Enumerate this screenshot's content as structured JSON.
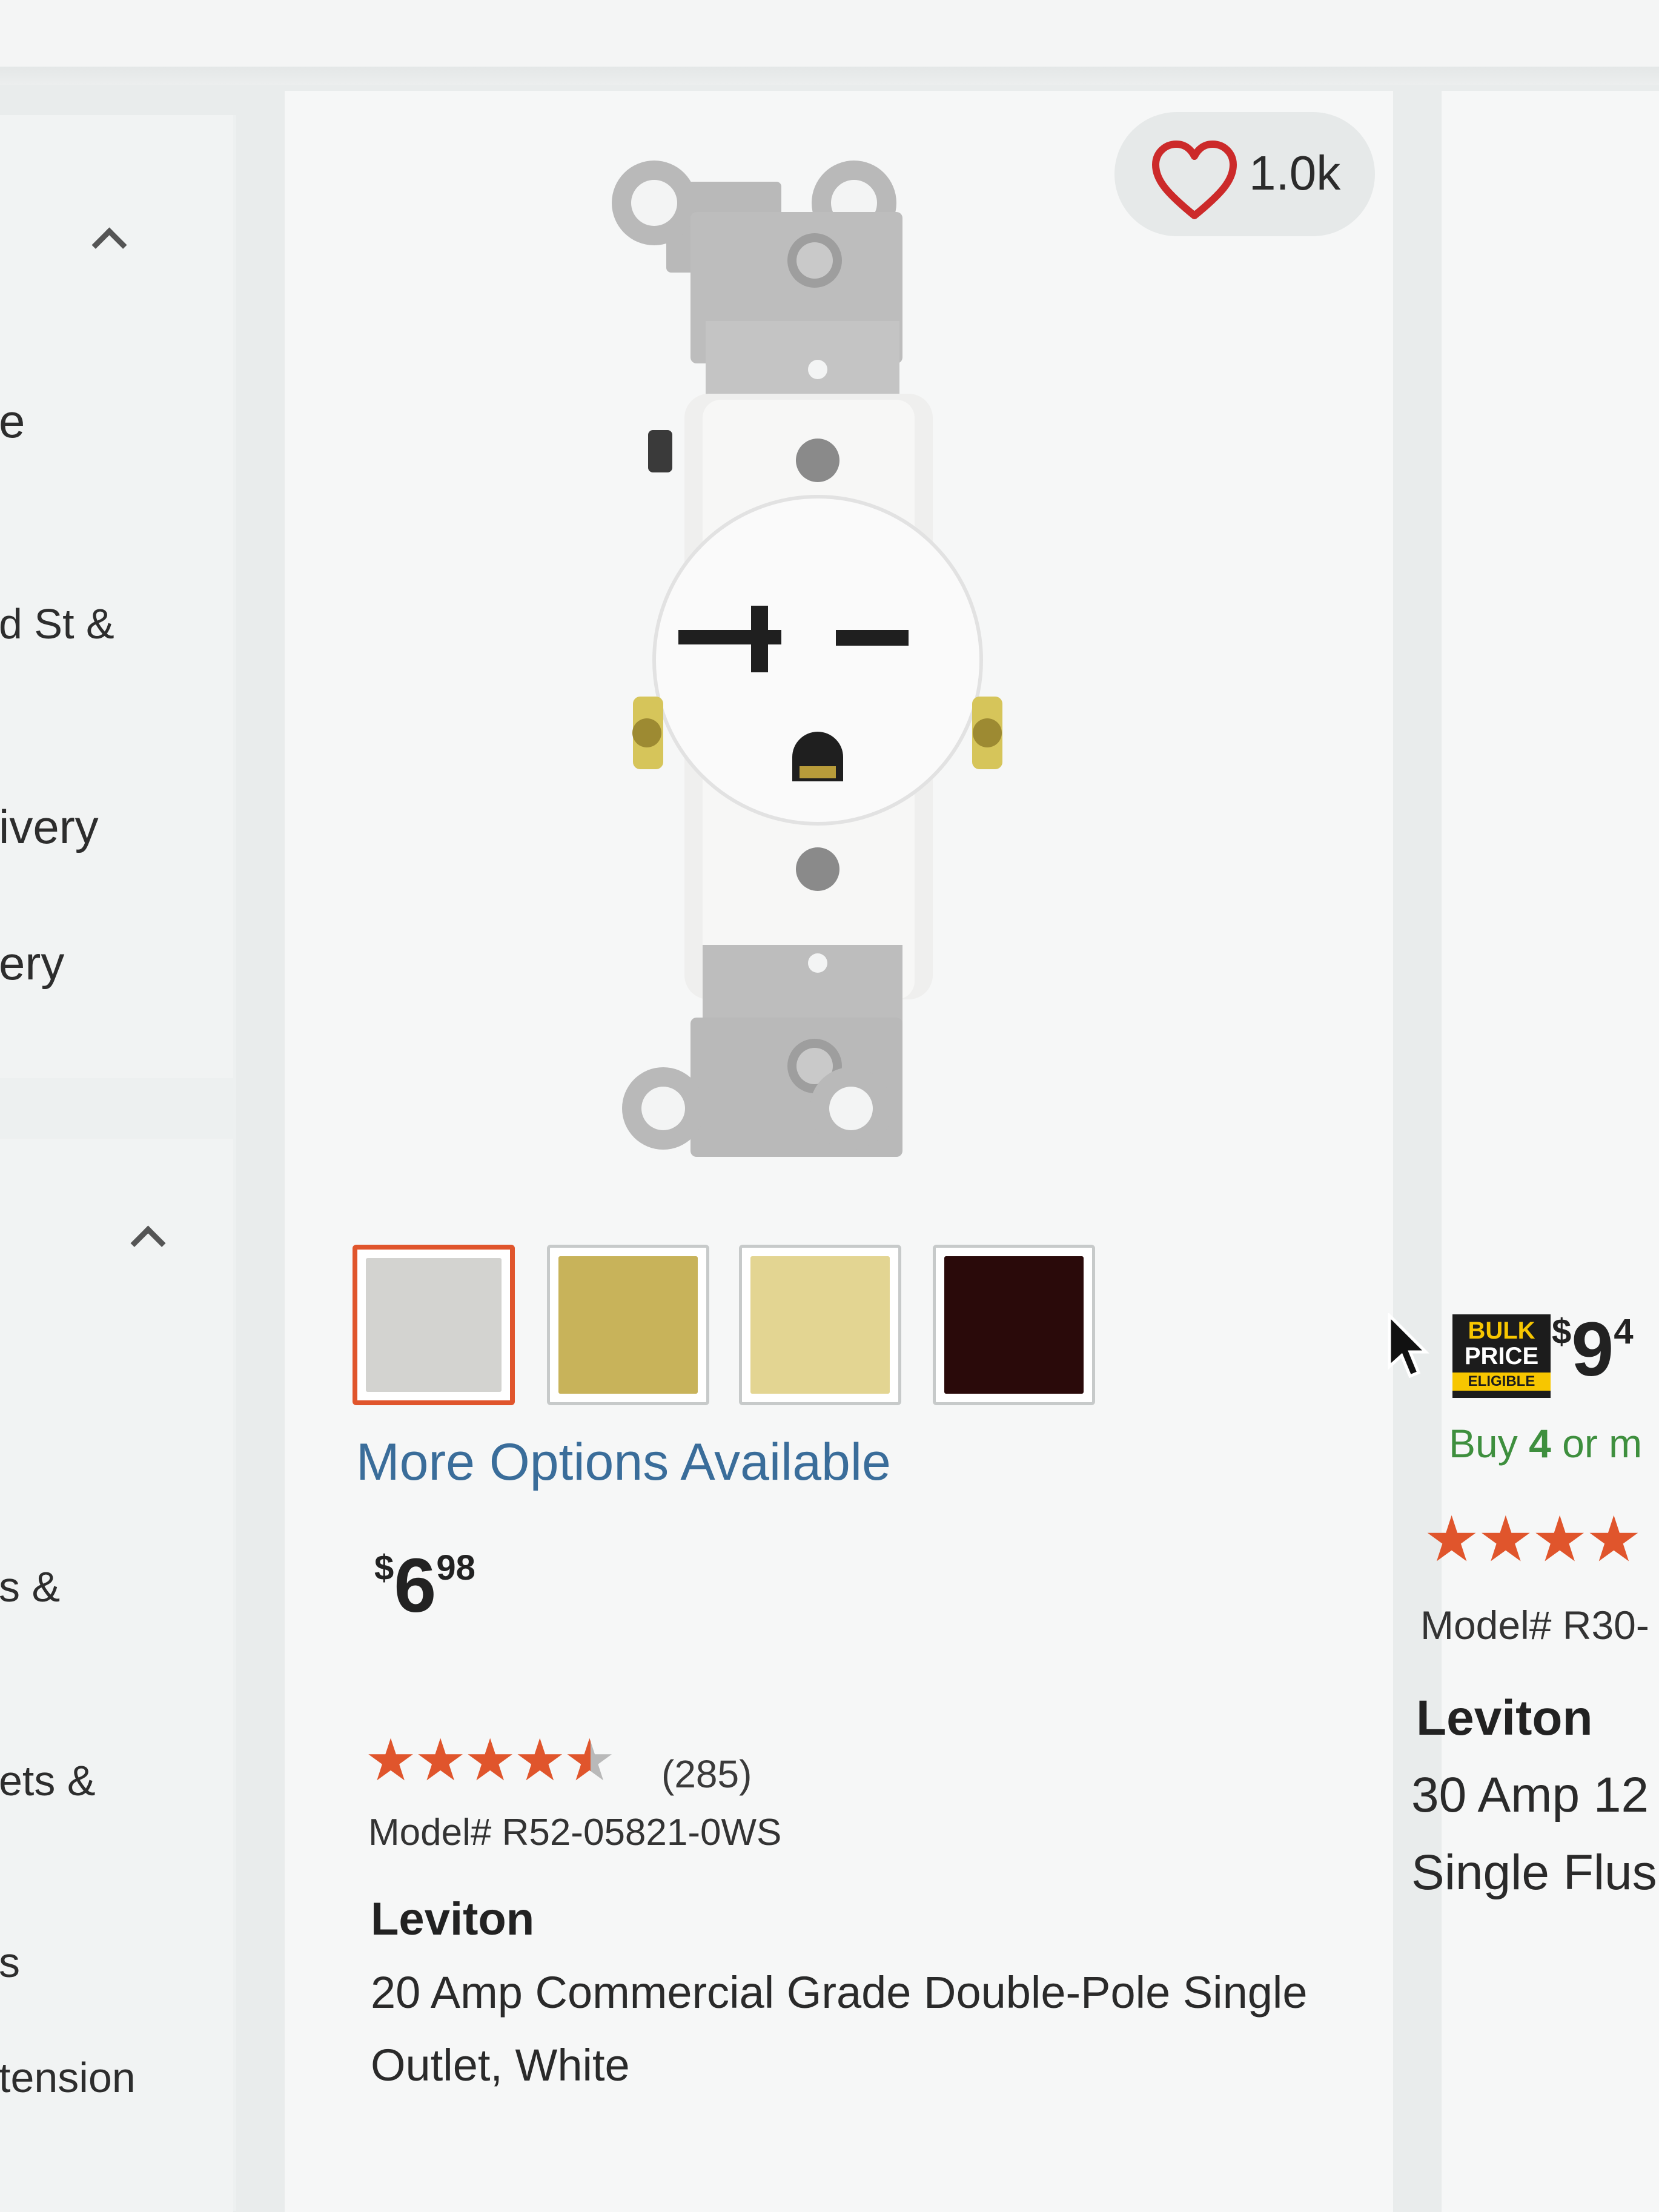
{
  "sidebar": {
    "items": [
      "e",
      "d St &",
      "ivery",
      "ery",
      "s &",
      "ets &",
      "s",
      "tension"
    ]
  },
  "product": {
    "favorites_count": "1.0k",
    "image_alt": "Leviton 20 Amp single outlet receptacle",
    "swatches": [
      {
        "color": "#d3d3d0",
        "selected": true
      },
      {
        "color": "#c8b35a",
        "selected": false
      },
      {
        "color": "#e3d592",
        "selected": false
      },
      {
        "color": "#2a0a0a",
        "selected": false
      }
    ],
    "more_options": "More Options Available",
    "price": {
      "currency": "$",
      "dollars": "6",
      "cents": "98"
    },
    "rating": {
      "stars": 4.5,
      "count": "(285)"
    },
    "model": "Model# R52-05821-0WS",
    "brand": "Leviton",
    "title": "20 Amp Commercial Grade Double-Pole Single Outlet, White"
  },
  "next_product": {
    "badge": {
      "line1": "BULK",
      "line2": "PRICE",
      "line3": "ELIGIBLE"
    },
    "price": {
      "currency": "$",
      "dollars": "9",
      "cents": "4"
    },
    "bulk_prefix": "Buy ",
    "bulk_qty": "4",
    "bulk_suffix": " or m",
    "model": "Model# R30-",
    "brand": "Leviton",
    "title_line1": "30 Amp 12",
    "title_line2": "Single Flus"
  },
  "colors": {
    "accent_orange": "#e0552c",
    "link_blue": "#3a6d9a",
    "bulk_green": "#3e8f3e"
  }
}
